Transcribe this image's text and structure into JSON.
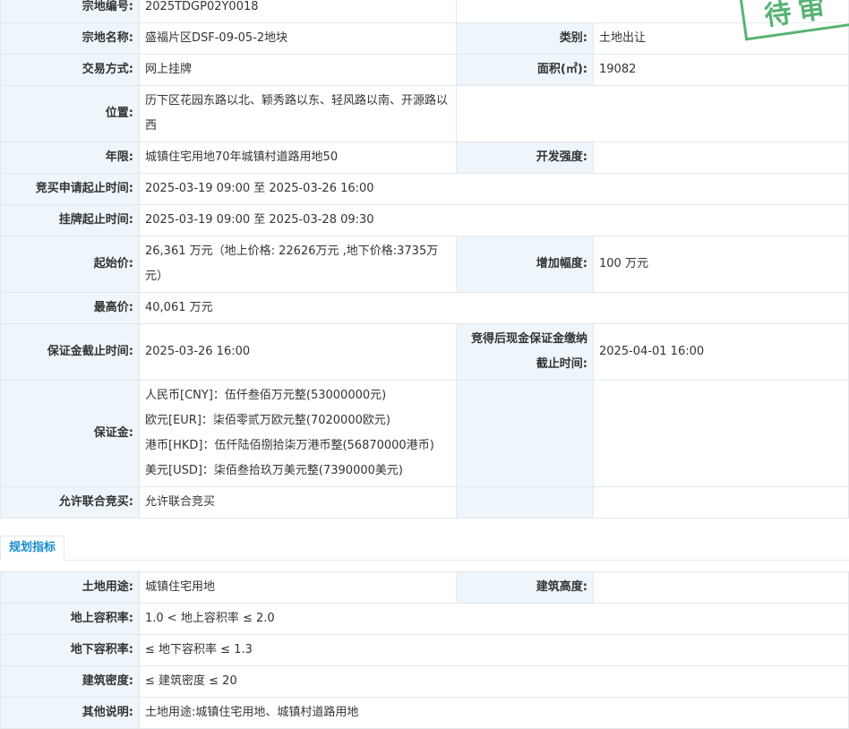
{
  "stamp_text": "待审",
  "land_info": {
    "parcel_no_label": "宗地编号:",
    "parcel_no": "2025TDGP02Y0018",
    "parcel_name_label": "宗地名称:",
    "parcel_name": "盛福片区DSF-09-05-2地块",
    "category_label": "类别:",
    "category": "土地出让",
    "trade_method_label": "交易方式:",
    "trade_method": "网上挂牌",
    "area_label": "面积(㎡):",
    "area": "19082",
    "location_label": "位置:",
    "location": "历下区花园东路以北、颖秀路以东、轻风路以南、开源路以西",
    "term_label": "年限:",
    "term": "城镇住宅用地70年城镇村道路用地50",
    "dev_intensity_label": "开发强度:",
    "dev_intensity": "",
    "apply_period_label": "竞买申请起止时间:",
    "apply_period": "2025-03-19 09:00 至 2025-03-26 16:00",
    "listing_period_label": "挂牌起止时间:",
    "listing_period": "2025-03-19 09:00 至 2025-03-28 09:30",
    "start_price_label": "起始价:",
    "start_price": "26,361 万元（地上价格: 22626万元 ,地下价格:3735万元）",
    "increment_label": "增加幅度:",
    "increment": "100 万元",
    "max_price_label": "最高价:",
    "max_price": "40,061 万元",
    "deposit_deadline_label": "保证金截止时间:",
    "deposit_deadline": "2025-03-26 16:00",
    "cash_deposit_deadline_label": "竞得后现金保证金缴纳截止时间:",
    "cash_deposit_deadline": "2025-04-01 16:00",
    "deposit_label": "保证金:",
    "deposits": [
      "人民币[CNY]：伍仟叁佰万元整(53000000元)",
      "欧元[EUR]：柒佰零贰万欧元整(7020000欧元)",
      "港币[HKD]：伍仟陆佰捌拾柒万港币整(56870000港币)",
      "美元[USD]：柒佰叁拾玖万美元整(7390000美元)"
    ],
    "joint_bid_label": "允许联合竞买:",
    "joint_bid": "允许联合竞买"
  },
  "planning_tab_label": "规划指标",
  "planning": {
    "land_use_label": "土地用途:",
    "land_use": "城镇住宅用地",
    "building_height_label": "建筑高度:",
    "building_height": "",
    "far_above_label": "地上容积率:",
    "far_above": "1.0 < 地上容积率 ≤ 2.0",
    "far_below_label": "地下容积率:",
    "far_below": "≤ 地下容积率 ≤ 1.3",
    "density_label": "建筑密度:",
    "density": "≤ 建筑密度 ≤ 20",
    "other_label": "其他说明:",
    "other": "土地用途:城镇住宅用地、城镇村道路用地"
  }
}
